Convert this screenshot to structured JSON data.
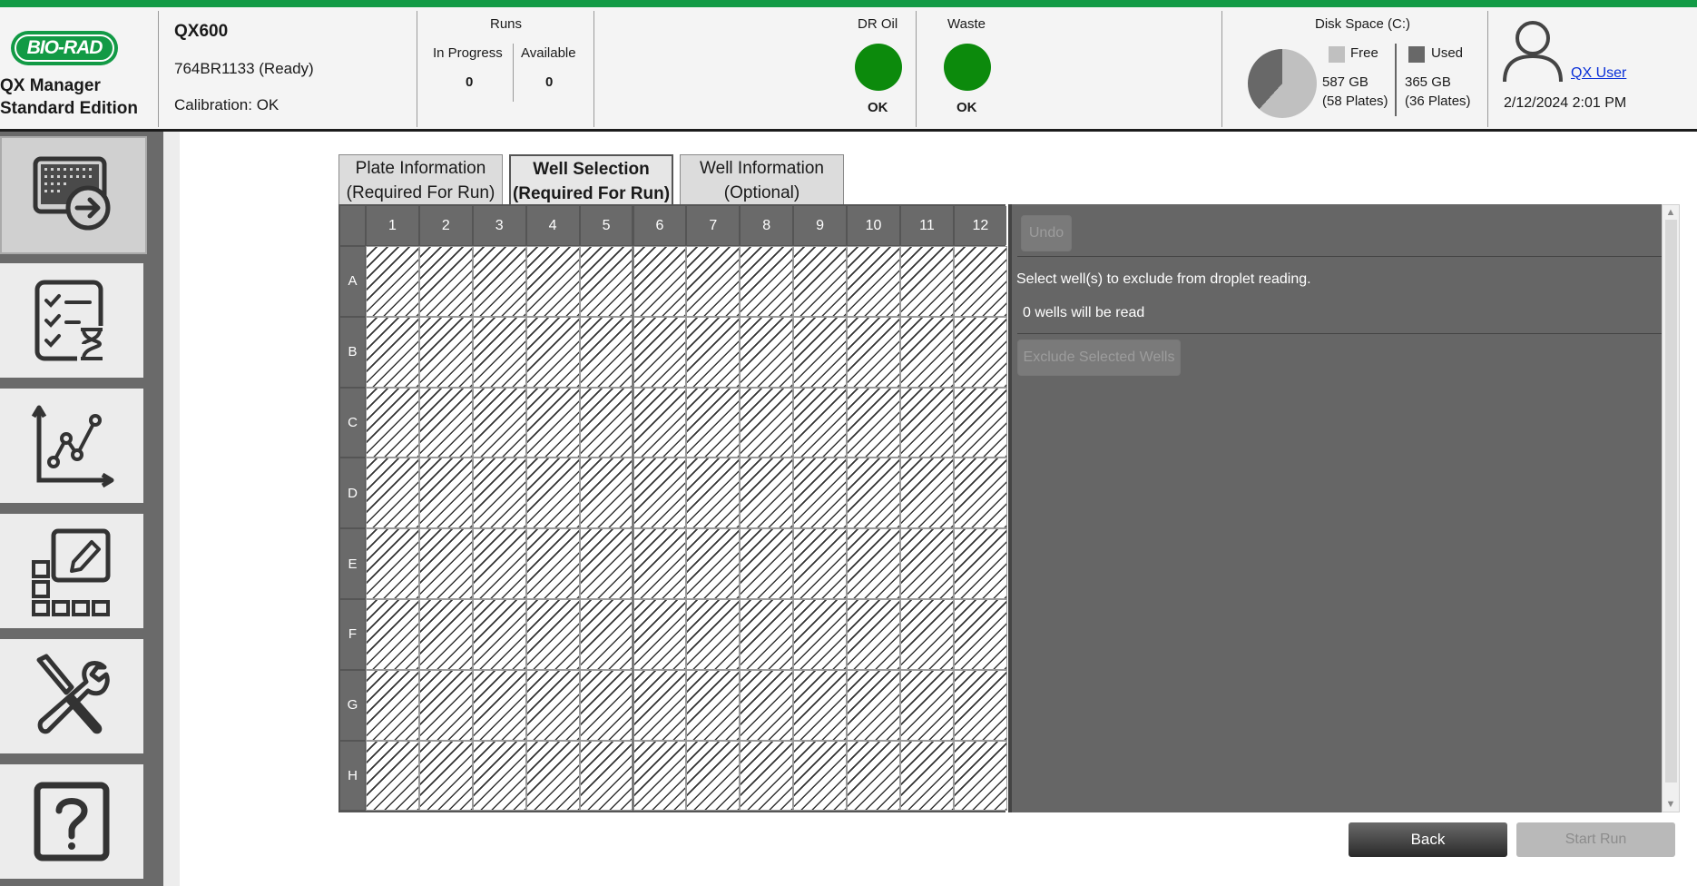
{
  "app": {
    "logo_text": "BIO-RAD",
    "name_line1": "QX Manager",
    "name_line2": "Standard Edition"
  },
  "device": {
    "name": "QX600",
    "serial": "764BR1133 (Ready)",
    "calibration": "Calibration: OK"
  },
  "runs": {
    "title": "Runs",
    "in_progress_label": "In Progress",
    "in_progress_value": "0",
    "available_label": "Available",
    "available_value": "0"
  },
  "dr_oil": {
    "label": "DR Oil",
    "status": "OK",
    "color": "#0c8a0c"
  },
  "waste": {
    "label": "Waste",
    "status": "OK",
    "color": "#0c8a0c"
  },
  "disk": {
    "title": "Disk Space (C:)",
    "free_label": "Free",
    "free_size": "587 GB",
    "free_plates": "(58 Plates)",
    "used_label": "Used",
    "used_size": "365 GB",
    "used_plates": "(36 Plates)",
    "free_color": "#c0c0c0",
    "used_color": "#686868"
  },
  "user": {
    "name": "QX User",
    "datetime": "2/12/2024 2:01 PM",
    "icon": "user-icon"
  },
  "nav": [
    {
      "id": "run",
      "icon": "plate-run-icon",
      "active": true
    },
    {
      "id": "pending",
      "icon": "checklist-hourglass-icon",
      "active": false
    },
    {
      "id": "analysis",
      "icon": "line-chart-icon",
      "active": false
    },
    {
      "id": "editor",
      "icon": "plate-editor-icon",
      "active": false
    },
    {
      "id": "tools",
      "icon": "tools-icon",
      "active": false
    },
    {
      "id": "help",
      "icon": "help-icon",
      "active": false
    }
  ],
  "tabs": [
    {
      "line1": "Plate Information",
      "line2": "(Required For Run)",
      "active": false
    },
    {
      "line1": "Well Selection",
      "line2": "(Required For Run)",
      "active": true
    },
    {
      "line1": "Well Information",
      "line2": "(Optional)",
      "active": false
    }
  ],
  "plate": {
    "columns": [
      "1",
      "2",
      "3",
      "4",
      "5",
      "6",
      "7",
      "8",
      "9",
      "10",
      "11",
      "12"
    ],
    "rows": [
      "A",
      "B",
      "C",
      "D",
      "E",
      "F",
      "G",
      "H"
    ]
  },
  "panel": {
    "undo_label": "Undo",
    "instruction": "Select well(s) to exclude from droplet reading.",
    "wells_count": "0 wells will be read",
    "exclude_label": "Exclude Selected Wells"
  },
  "footer": {
    "back_label": "Back",
    "start_label": "Start Run"
  }
}
